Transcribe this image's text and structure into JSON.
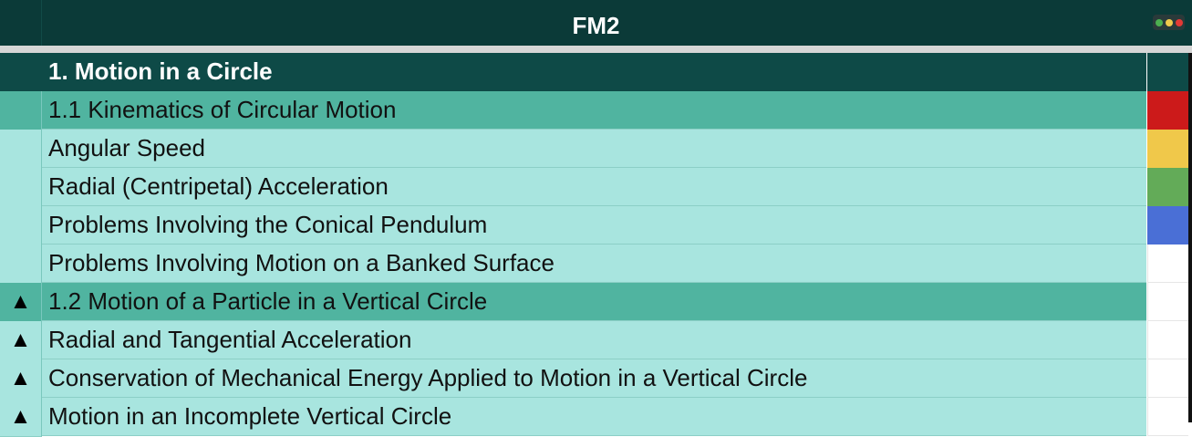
{
  "window": {
    "title": "FM2",
    "controls": {
      "green": "#4caf50",
      "yellow": "#f2c94c",
      "red": "#e53935"
    }
  },
  "rows": [
    {
      "kind": "header",
      "marker": "",
      "label": "1. Motion in a Circle",
      "swatch": "#0e4a47"
    },
    {
      "kind": "section",
      "marker": "",
      "label": "1.1 Kinematics of Circular Motion",
      "swatch": "#cc1a1a"
    },
    {
      "kind": "item",
      "marker": "",
      "label": "Angular Speed",
      "swatch": "#f0c84a"
    },
    {
      "kind": "item",
      "marker": "",
      "label": "Radial (Centripetal) Acceleration",
      "swatch": "#63ab58"
    },
    {
      "kind": "item",
      "marker": "",
      "label": "Problems Involving the Conical Pendulum",
      "swatch": "#4a6fd6"
    },
    {
      "kind": "item",
      "marker": "",
      "label": "Problems Involving Motion on a Banked Surface",
      "swatch": "#ffffff"
    },
    {
      "kind": "section",
      "marker": "▲",
      "label": "1.2 Motion of a Particle in a Vertical Circle",
      "swatch": "#ffffff"
    },
    {
      "kind": "item",
      "marker": "▲",
      "label": "Radial and Tangential Acceleration",
      "swatch": "#ffffff"
    },
    {
      "kind": "item",
      "marker": "▲",
      "label": "Conservation of Mechanical Energy Applied to Motion in a Vertical Circle",
      "swatch": "#ffffff"
    },
    {
      "kind": "item",
      "marker": "▲",
      "label": "Motion in an Incomplete Vertical Circle",
      "swatch": "#ffffff"
    }
  ]
}
